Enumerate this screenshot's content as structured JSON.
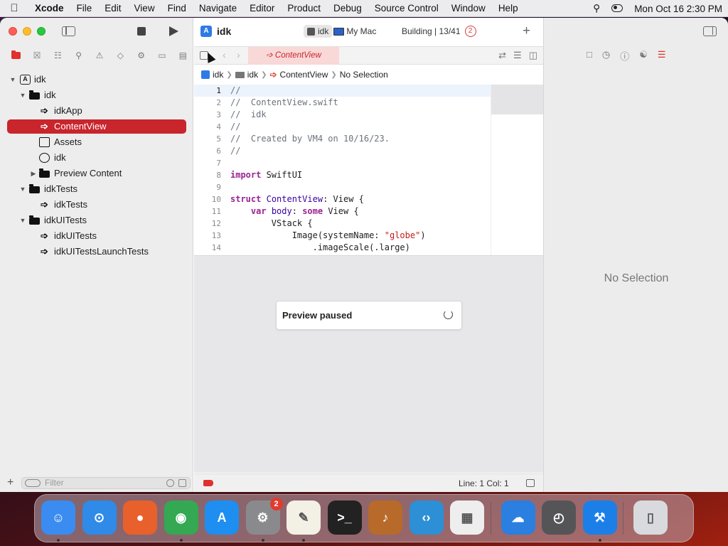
{
  "menubar": {
    "app_name": "Xcode",
    "items": [
      "File",
      "Edit",
      "View",
      "Find",
      "Navigate",
      "Editor",
      "Product",
      "Debug",
      "Source Control",
      "Window",
      "Help"
    ],
    "clock": "Mon Oct 16  2:30 PM"
  },
  "toolbar": {
    "project_name": "idk",
    "scheme": "idk",
    "destination": "My Mac",
    "build_status": "Building | 13/41",
    "error_count": "2"
  },
  "navigator": {
    "tree": [
      {
        "label": "idk",
        "icon": "project-icon",
        "level": 0,
        "expanded": true
      },
      {
        "label": "idk",
        "icon": "folder-icon",
        "level": 1,
        "expanded": true
      },
      {
        "label": "idkApp",
        "icon": "swift-file-icon",
        "level": 2
      },
      {
        "label": "ContentView",
        "icon": "swift-file-icon",
        "level": 2,
        "selected": true
      },
      {
        "label": "Assets",
        "icon": "asset-catalog-icon",
        "level": 2
      },
      {
        "label": "idk",
        "icon": "entitlements-icon",
        "level": 2
      },
      {
        "label": "Preview Content",
        "icon": "folder-icon",
        "level": 2,
        "collapsed": true
      },
      {
        "label": "idkTests",
        "icon": "folder-icon",
        "level": 1,
        "expanded": true
      },
      {
        "label": "idkTests",
        "icon": "swift-file-icon",
        "level": 2
      },
      {
        "label": "idkUITests",
        "icon": "folder-icon",
        "level": 1,
        "expanded": true
      },
      {
        "label": "idkUITests",
        "icon": "swift-file-icon",
        "level": 2
      },
      {
        "label": "idkUITestsLaunchTests",
        "icon": "swift-file-icon",
        "level": 2
      }
    ],
    "filter_placeholder": "Filter"
  },
  "editor": {
    "tab_title": "ContentView",
    "breadcrumb": [
      "idk",
      "idk",
      "ContentView",
      "No Selection"
    ],
    "lines": [
      {
        "n": "1",
        "html": "<span class=\"cm\">//</span>"
      },
      {
        "n": "2",
        "html": "<span class=\"cm\">//  ContentView.swift</span>"
      },
      {
        "n": "3",
        "html": "<span class=\"cm\">//  idk</span>"
      },
      {
        "n": "4",
        "html": "<span class=\"cm\">//</span>"
      },
      {
        "n": "5",
        "html": "<span class=\"cm\">//  Created by VM4 on 10/16/23.</span>"
      },
      {
        "n": "6",
        "html": "<span class=\"cm\">//</span>"
      },
      {
        "n": "7",
        "html": ""
      },
      {
        "n": "8",
        "html": "<span class=\"kw\">import</span> SwiftUI"
      },
      {
        "n": "9",
        "html": ""
      },
      {
        "n": "10",
        "html": "<span class=\"kw\">struct</span> <span class=\"ty\">ContentView</span>: View {"
      },
      {
        "n": "11",
        "html": "    <span class=\"kw\">var</span> <span class=\"ty\">body</span>: <span class=\"kw\">some</span> View {"
      },
      {
        "n": "12",
        "html": "        VStack {"
      },
      {
        "n": "13",
        "html": "            Image(systemName: <span class=\"st\">\"globe\"</span>)"
      },
      {
        "n": "14",
        "html": "                .imageScale(.large)"
      }
    ],
    "preview_status": "Preview paused",
    "line_col": "Line: 1  Col: 1"
  },
  "inspector": {
    "empty_text": "No Selection"
  },
  "dock": {
    "apps": [
      {
        "name": "Finder",
        "icon": "finder-icon",
        "color": "#3a8cf0",
        "running": true
      },
      {
        "name": "Safari",
        "icon": "safari-icon",
        "color": "#2f8ae8",
        "running": false
      },
      {
        "name": "Firefox",
        "icon": "firefox-icon",
        "color": "#e8602c",
        "running": false
      },
      {
        "name": "Chrome",
        "icon": "chrome-icon",
        "color": "#34a853",
        "running": true
      },
      {
        "name": "App Store",
        "icon": "app-store-icon",
        "color": "#1e8ef0",
        "running": false
      },
      {
        "name": "System Settings",
        "icon": "settings-icon",
        "color": "#8a8a8e",
        "running": true,
        "badge": "2"
      },
      {
        "name": "TextEdit",
        "icon": "textedit-icon",
        "color": "#f3f0e6",
        "running": true
      },
      {
        "name": "Terminal",
        "icon": "terminal-icon",
        "color": "#222222",
        "running": false
      },
      {
        "name": "GarageBand",
        "icon": "garageband-icon",
        "color": "#b86a2a",
        "running": false
      },
      {
        "name": "VS Code",
        "icon": "vscode-icon",
        "color": "#2d8fd5",
        "running": false
      },
      {
        "name": "Launchpad",
        "icon": "launchpad-icon",
        "color": "#eeeeee",
        "running": false
      },
      {
        "name": "Weather",
        "icon": "weather-icon",
        "color": "#2a7fe0",
        "running": false
      },
      {
        "name": "Activity",
        "icon": "activity-icon",
        "color": "#555558",
        "running": false
      },
      {
        "name": "Xcode",
        "icon": "xcode-icon",
        "color": "#1c7fe8",
        "running": true
      },
      {
        "name": "Trash",
        "icon": "trash-icon",
        "color": "#d8dadd",
        "running": false
      }
    ]
  },
  "colors": {
    "accent": "#c9252c",
    "tab_bg": "#f9d8d8",
    "keyword": "#9b2393",
    "string": "#c41a16"
  }
}
